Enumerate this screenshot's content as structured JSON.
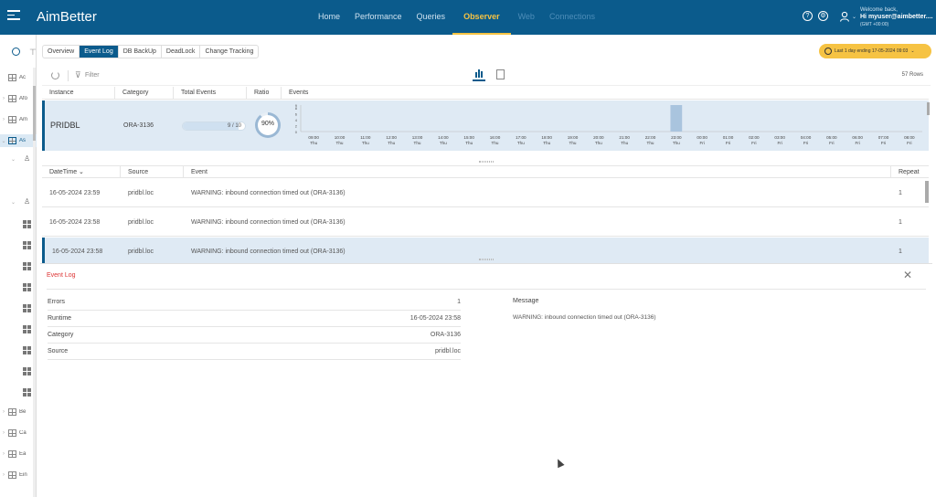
{
  "app": {
    "logo": "AimBetter",
    "nav": [
      "Home",
      "Performance",
      "Queries",
      "Observer",
      "Web",
      "Connections"
    ],
    "nav_active": "Observer",
    "user": {
      "welcome": "Welcome back,",
      "name": "Hi myuser@aimbetter....",
      "timezone": "(GMT +00:00)"
    }
  },
  "sidebar": {
    "items": [
      {
        "label": "Ac"
      },
      {
        "label": "Afo"
      },
      {
        "label": "Am"
      },
      {
        "label": "As"
      },
      {
        "label": "Be"
      },
      {
        "label": "Ca"
      },
      {
        "label": "Ea"
      },
      {
        "label": "Ein"
      }
    ]
  },
  "tabs": [
    "Overview",
    "Event Log",
    "DB BackUp",
    "DeadLock",
    "Change Tracking"
  ],
  "tab_active": "Event Log",
  "date_filter": "Last 1 day ending  17-05-2024 09:03",
  "toolbar": {
    "filter_label": "Filter",
    "rows_count": "57 Rows"
  },
  "instance_table": {
    "headers": [
      "Instance",
      "Category",
      "Total Events",
      "Ratio",
      "Events"
    ],
    "row": {
      "instance": "PRIDBL",
      "category": "ORA-3136",
      "total_events": "9 / 10",
      "total_fraction": 0.9,
      "ratio": "90%",
      "ratio_value": 90
    }
  },
  "chart_data": {
    "type": "bar",
    "title": "",
    "xlabel": "",
    "ylabel": "",
    "ylim": [
      0,
      9
    ],
    "y_ticks": [
      "9",
      "8",
      "6",
      "4",
      "2",
      "0"
    ],
    "categories": [
      [
        "09:00",
        "Thu"
      ],
      [
        "10:00",
        "Thu"
      ],
      [
        "11:00",
        "Thu"
      ],
      [
        "12:00",
        "Thu"
      ],
      [
        "13:00",
        "Thu"
      ],
      [
        "14:00",
        "Thu"
      ],
      [
        "15:00",
        "Thu"
      ],
      [
        "16:00",
        "Thu"
      ],
      [
        "17:00",
        "Thu"
      ],
      [
        "18:00",
        "Thu"
      ],
      [
        "19:00",
        "Thu"
      ],
      [
        "20:00",
        "Thu"
      ],
      [
        "21:00",
        "Thu"
      ],
      [
        "22:00",
        "Thu"
      ],
      [
        "23:00",
        "Thu"
      ],
      [
        "00:00",
        "Fri"
      ],
      [
        "01:00",
        "Fri"
      ],
      [
        "02:00",
        "Fri"
      ],
      [
        "03:00",
        "Fri"
      ],
      [
        "04:00",
        "Fri"
      ],
      [
        "05:00",
        "Fri"
      ],
      [
        "06:00",
        "Fri"
      ],
      [
        "07:00",
        "Fri"
      ],
      [
        "08:00",
        "Fri"
      ]
    ],
    "values": [
      0,
      0,
      0,
      0,
      0,
      0,
      0,
      0,
      0,
      0,
      0,
      0,
      0,
      0,
      9,
      0,
      0,
      0,
      0,
      0,
      0,
      0,
      0,
      0
    ],
    "bar_color": "#a9c4de",
    "grid": false,
    "legend": "none"
  },
  "event_table": {
    "headers": [
      "DateTime",
      "Source",
      "Event",
      "Repeat"
    ],
    "rows": [
      {
        "datetime": "16-05-2024 23:59",
        "source": "pridbl.loc",
        "event": "WARNING: inbound connection timed out (ORA-3136)",
        "repeat": "1"
      },
      {
        "datetime": "16-05-2024 23:58",
        "source": "pridbl.loc",
        "event": "WARNING: inbound connection timed out (ORA-3136)",
        "repeat": "1"
      },
      {
        "datetime": "16-05-2024 23:58",
        "source": "pridbl.loc",
        "event": "WARNING: inbound connection timed out (ORA-3136)",
        "repeat": "1"
      }
    ]
  },
  "detail": {
    "title": "Event Log",
    "fields": [
      {
        "key": "Errors",
        "value": "1"
      },
      {
        "key": "Runtime",
        "value": "16-05-2024 23:58"
      },
      {
        "key": "Category",
        "value": "ORA-3136"
      },
      {
        "key": "Source",
        "value": "pridbl.loc"
      }
    ],
    "message_label": "Message",
    "message": "WARNING: inbound connection timed out (ORA-3136)"
  },
  "colors": {
    "brand": "#0b5b8c",
    "accent": "#f6c343",
    "error_title": "#dd3333"
  }
}
